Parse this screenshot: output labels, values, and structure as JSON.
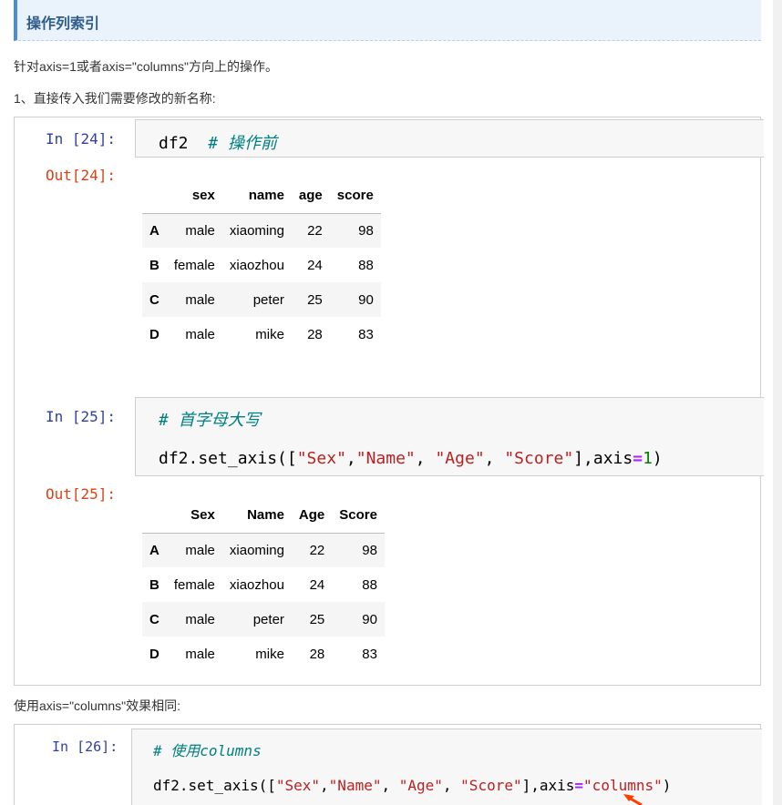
{
  "heading": "操作列索引",
  "intro_text": "针对axis=1或者axis=\"columns\"方向上的操作。",
  "step1_text": "1、直接传入我们需要修改的新名称:",
  "cell24": {
    "in_prompt": "In [24]:",
    "code_var": "df2",
    "code_comment": "# 操作前",
    "out_prompt": "Out[24]:",
    "table": {
      "columns": [
        "sex",
        "name",
        "age",
        "score"
      ],
      "rows": [
        {
          "index": "A",
          "values": [
            "male",
            "xiaoming",
            "22",
            "98"
          ]
        },
        {
          "index": "B",
          "values": [
            "female",
            "xiaozhou",
            "24",
            "88"
          ]
        },
        {
          "index": "C",
          "values": [
            "male",
            "peter",
            "25",
            "90"
          ]
        },
        {
          "index": "D",
          "values": [
            "male",
            "mike",
            "28",
            "83"
          ]
        }
      ]
    }
  },
  "cell25": {
    "in_prompt": "In [25]:",
    "comment": "# 首字母大写",
    "code": {
      "prefix": "df2.set_axis([",
      "s1": "\"Sex\"",
      "sep1": ",",
      "s2": "\"Name\"",
      "sep2": ", ",
      "s3": "\"Age\"",
      "sep3": ", ",
      "s4": "\"Score\"",
      "mid": "],axis",
      "eq": "=",
      "num": "1",
      "end": ")"
    },
    "out_prompt": "Out[25]:",
    "table": {
      "columns": [
        "Sex",
        "Name",
        "Age",
        "Score"
      ],
      "rows": [
        {
          "index": "A",
          "values": [
            "male",
            "xiaoming",
            "22",
            "98"
          ]
        },
        {
          "index": "B",
          "values": [
            "female",
            "xiaozhou",
            "24",
            "88"
          ]
        },
        {
          "index": "C",
          "values": [
            "male",
            "peter",
            "25",
            "90"
          ]
        },
        {
          "index": "D",
          "values": [
            "male",
            "mike",
            "28",
            "83"
          ]
        }
      ]
    }
  },
  "columns_text": "使用axis=\"columns\"效果相同:",
  "cell26": {
    "in_prompt": "In [26]:",
    "comment": "# 使用columns",
    "code": {
      "prefix": "df2.set_axis([",
      "s1": "\"Sex\"",
      "sep1": ",",
      "s2": "\"Name\"",
      "sep2": ", ",
      "s3": "\"Age\"",
      "sep3": ", ",
      "s4": "\"Score\"",
      "mid": "],axis",
      "eq": "=",
      "str": "\"columns\"",
      "end": ")"
    }
  }
}
